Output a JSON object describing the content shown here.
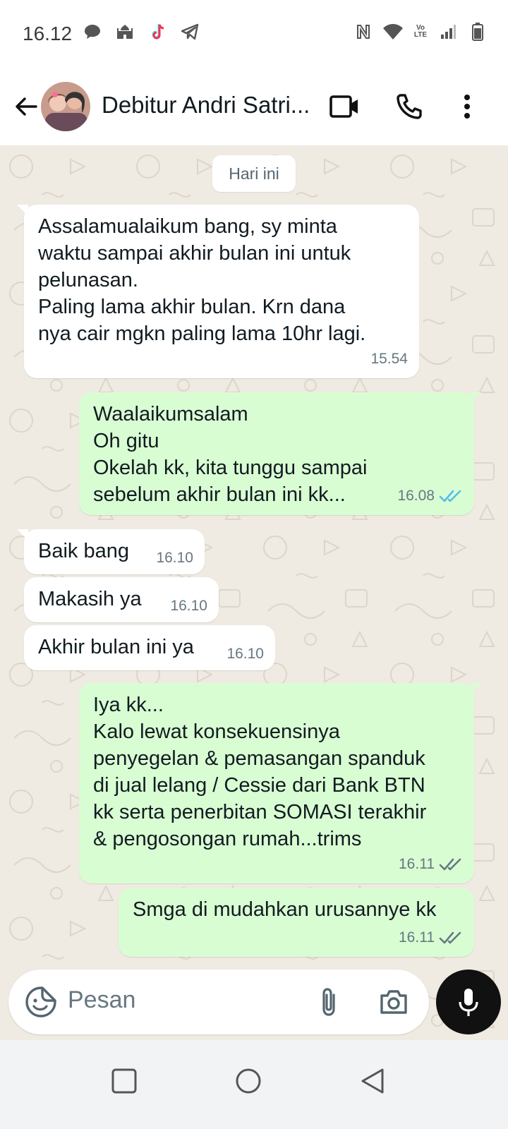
{
  "status_bar": {
    "time": "16.12",
    "left_icons": [
      "chat-bubble-icon",
      "mosque-icon",
      "tiktok-icon",
      "telegram-icon"
    ],
    "right_icons": [
      "nfc-icon",
      "wifi-icon",
      "volte-icon",
      "signal-icon",
      "battery-icon"
    ],
    "volte_label": "Vo LTE"
  },
  "header": {
    "contact_name": "Debitur Andri Satri...",
    "video_call_icon": "video-camera-icon",
    "voice_call_icon": "phone-icon",
    "menu_icon": "more-vertical-icon"
  },
  "chat": {
    "date_chip": "Hari ini",
    "messages": [
      {
        "direction": "in",
        "text": "Assalamualaikum bang, sy minta\nwaktu sampai akhir bulan ini untuk\npelunasan.\nPaling lama akhir bulan. Krn dana\nnya cair mgkn paling lama 10hr lagi.",
        "time": "15.54"
      },
      {
        "direction": "out",
        "text": "Waalaikumsalam\nOh gitu\nOkelah kk, kita tunggu sampai\nsebelum akhir bulan ini kk...",
        "time": "16.08",
        "status": "read"
      },
      {
        "direction": "in",
        "text": "Baik bang",
        "time": "16.10"
      },
      {
        "direction": "in",
        "text": "Makasih ya",
        "time": "16.10"
      },
      {
        "direction": "in",
        "text": "Akhir bulan ini ya",
        "time": "16.10"
      },
      {
        "direction": "out",
        "text": "Iya kk...\nKalo lewat konsekuensinya\npenyegelan & pemasangan spanduk\ndi jual lelang / Cessie dari Bank BTN\nkk serta penerbitan SOMASI terakhir\n& pengosongan rumah...trims",
        "time": "16.11",
        "status": "delivered"
      },
      {
        "direction": "out",
        "text": "Smga di mudahkan urusannye kk",
        "time": "16.11",
        "status": "delivered"
      }
    ]
  },
  "composer": {
    "placeholder": "Pesan",
    "emoji_icon": "sticker-icon",
    "attach_icon": "paperclip-icon",
    "camera_icon": "camera-icon",
    "mic_icon": "microphone-icon"
  },
  "navigation": {
    "buttons": [
      "recents-square-icon",
      "home-circle-icon",
      "back-triangle-icon"
    ]
  },
  "colors": {
    "chat_background": "#efeae2",
    "incoming_bubble": "#ffffff",
    "outgoing_bubble": "#d9fdd3",
    "read_tick": "#53bdeb",
    "delivered_tick": "#667781",
    "mic_button": "#111111"
  }
}
